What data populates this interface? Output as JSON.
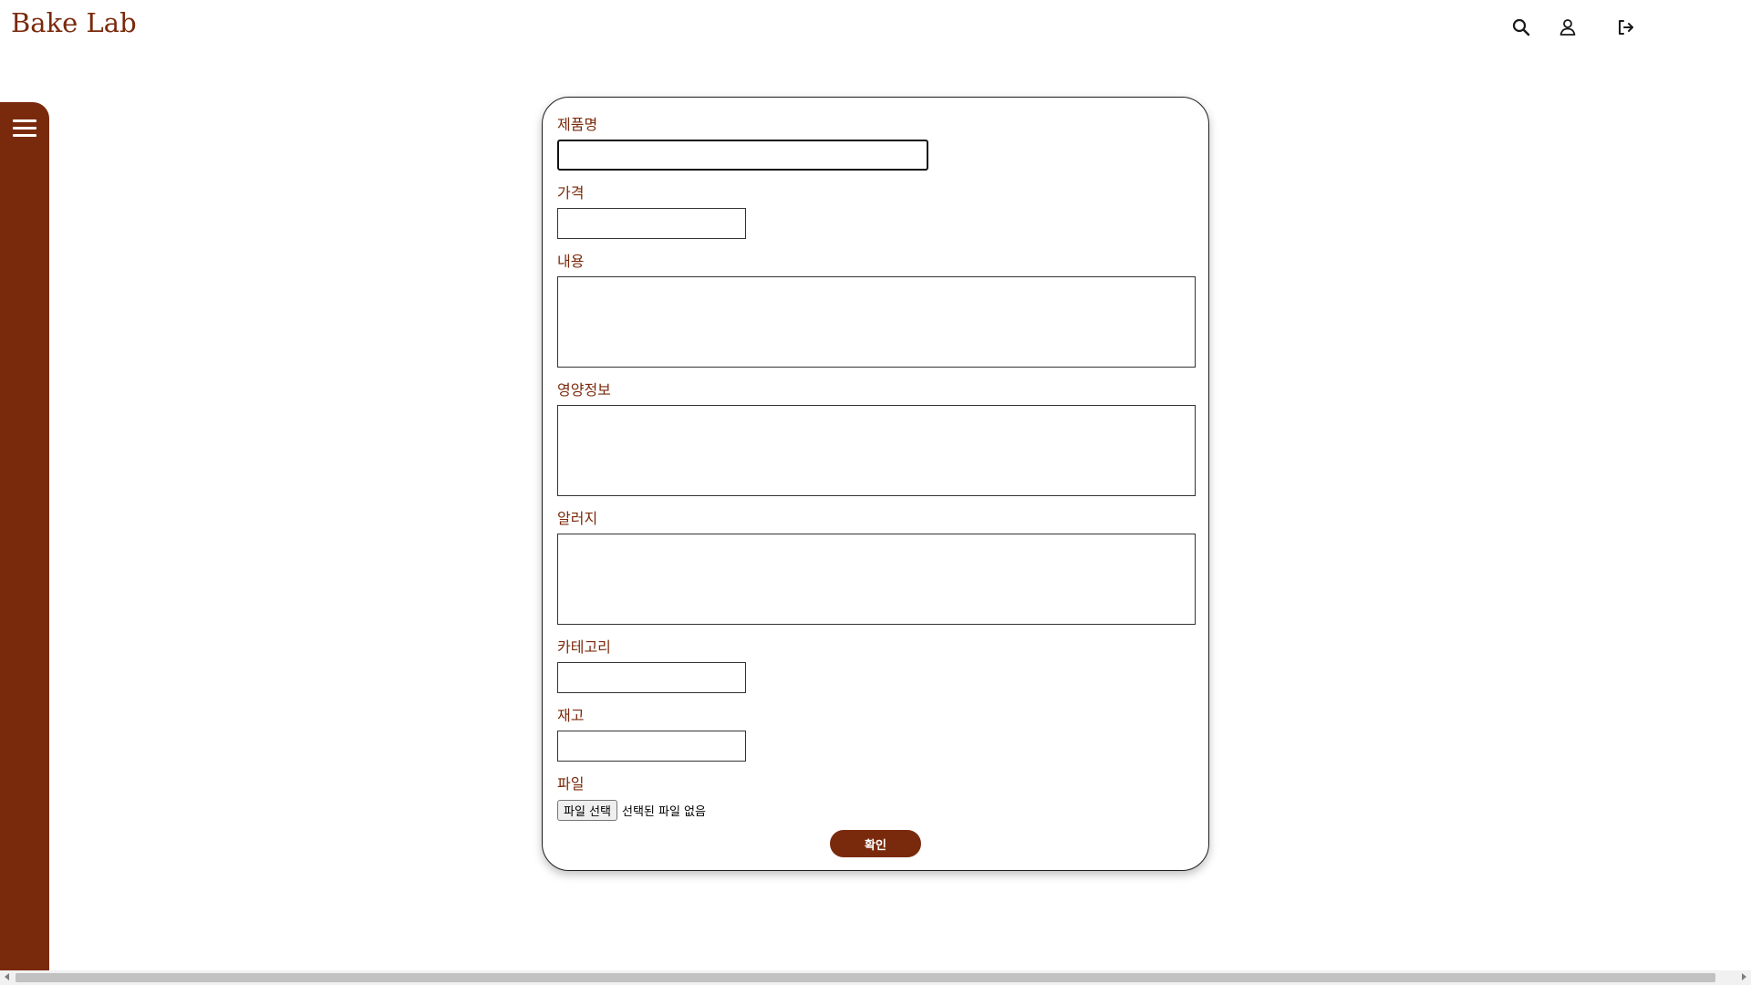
{
  "header": {
    "brand": "Bake Lab",
    "icons": [
      "search-icon",
      "user-icon",
      "logout-icon"
    ]
  },
  "sidebar": {
    "menu_icon": "hamburger-menu-icon"
  },
  "form": {
    "product_name_label": "제품명",
    "product_name_value": "",
    "price_label": "가격",
    "price_value": "",
    "content_label": "내용",
    "content_value": "",
    "nutrition_label": "영양정보",
    "nutrition_value": "",
    "allergy_label": "알러지",
    "allergy_value": "",
    "category_label": "카테고리",
    "category_value": "",
    "stock_label": "재고",
    "stock_value": "",
    "file_label": "파일",
    "file_button": "파일 선택",
    "file_status": "선택된 파일 없음",
    "submit_label": "확인"
  },
  "colors": {
    "brand": "#7a2a0c",
    "text": "#7a2a0c",
    "button_text": "#ffffff"
  }
}
